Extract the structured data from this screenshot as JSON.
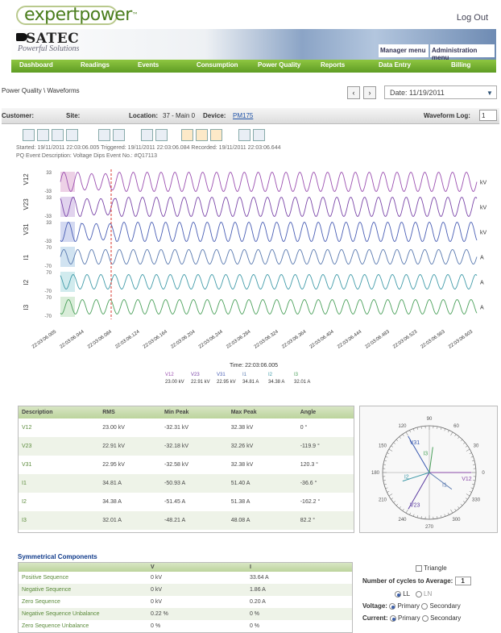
{
  "header": {
    "logo_main": "expertpower",
    "logo_tm": "™",
    "logout": "Log Out",
    "brand": "SATEC",
    "tagline": "Powerful Solutions",
    "manager_menu": "Manager menu",
    "admin_menu": "Administration menu"
  },
  "nav": [
    "Dashboard",
    "Readings",
    "Events",
    "Consumption",
    "Power Quality",
    "Reports",
    "Data Entry",
    "Billing"
  ],
  "breadcrumb": "Power Quality \\ Waveforms",
  "date": {
    "label": "Date: 11/19/2011",
    "prev": "‹",
    "next": "›",
    "caret": "▼"
  },
  "filters": {
    "customer": "Customer:",
    "site": "Site:",
    "location_label": "Location:",
    "location_value": "37 - Main 0",
    "device_label": "Device:",
    "device_value": "PM175",
    "waveform_log_label": "Waveform Log:",
    "waveform_log_value": "1"
  },
  "info": {
    "line1": "Started: 19/11/2011 22:03:06.005  Triggered: 19/11/2011 22:03:06.084  Recorded: 19/11/2011 22:03:06.644",
    "line2": "PQ Event Description: Voltage Dips  Event No.: #Q17113"
  },
  "waveform": {
    "channels": [
      {
        "name": "V12",
        "top": "33",
        "bottom": "-33",
        "color": "#9b4fb0",
        "band": "#e8c6e0",
        "unit": "kV"
      },
      {
        "name": "V23",
        "top": "33",
        "bottom": "-33",
        "color": "#7a45a8",
        "band": "#d9c8ea",
        "unit": "kV"
      },
      {
        "name": "V31",
        "top": "33",
        "bottom": "-33",
        "color": "#4a5fb5",
        "band": "#c8d0ee",
        "unit": "kV"
      },
      {
        "name": "I1",
        "top": "70",
        "bottom": "-70",
        "color": "#5a7ab0",
        "band": "#c6dcee",
        "unit": "A"
      },
      {
        "name": "I2",
        "top": "70",
        "bottom": "-70",
        "color": "#3f9aa8",
        "band": "#c6e6ea",
        "unit": "A"
      },
      {
        "name": "I3",
        "top": "70",
        "bottom": "-70",
        "color": "#4aa05a",
        "band": "#cfe8cf",
        "unit": "A"
      }
    ],
    "time_ticks": [
      "22:03:06.005",
      "22:03:06.044",
      "22:03:06.084",
      "22:03:06.124",
      "22:03:06.164",
      "22:03:06.204",
      "22:03:06.244",
      "22:03:06.284",
      "22:03:06.324",
      "22:03:06.364",
      "22:03:06.404",
      "22:03:06.444",
      "22:03:06.483",
      "22:03:06.523",
      "22:03:06.563",
      "22:03:06.603"
    ],
    "time_label": "Time: 22:03:06.005",
    "readout": [
      {
        "name": "V12",
        "value": "23.00 kV"
      },
      {
        "name": "V23",
        "value": "22.91 kV"
      },
      {
        "name": "V31",
        "value": "22.95 kV"
      },
      {
        "name": "I1",
        "value": "34.81 A"
      },
      {
        "name": "I2",
        "value": "34.38 A"
      },
      {
        "name": "I3",
        "value": "32.01 A"
      }
    ]
  },
  "table": {
    "headers": [
      "Description",
      "RMS",
      "Min Peak",
      "Max Peak",
      "Angle"
    ],
    "rows": [
      [
        "V12",
        "23.00 kV",
        "-32.31 kV",
        "32.38 kV",
        "0 °"
      ],
      [
        "V23",
        "22.91 kV",
        "-32.18 kV",
        "32.26 kV",
        "-119.9 °"
      ],
      [
        "V31",
        "22.95 kV",
        "-32.58 kV",
        "32.38 kV",
        "120.3 °"
      ],
      [
        "I1",
        "34.81 A",
        "-50.93 A",
        "51.40 A",
        "-36.6 °"
      ],
      [
        "I2",
        "34.38 A",
        "-51.45 A",
        "51.38 A",
        "-162.2 °"
      ],
      [
        "I3",
        "32.01 A",
        "-48.21 A",
        "48.08 A",
        "82.2 °"
      ]
    ]
  },
  "phasor": {
    "angles": [
      "90",
      "60",
      "30",
      "0",
      "330",
      "300",
      "270",
      "240",
      "210",
      "180",
      "150",
      "120"
    ],
    "vectors": [
      {
        "name": "V12",
        "angle": 0,
        "mag": 0.9,
        "color": "#8a4aa8"
      },
      {
        "name": "V23",
        "angle": -119.9,
        "mag": 0.9,
        "color": "#5a3aa0"
      },
      {
        "name": "V31",
        "angle": 120.3,
        "mag": 0.9,
        "color": "#3a5ab0"
      },
      {
        "name": "I1",
        "angle": -36.6,
        "mag": 0.6,
        "color": "#5a7ab0"
      },
      {
        "name": "I2",
        "angle": -162.2,
        "mag": 0.6,
        "color": "#3f9aa8"
      },
      {
        "name": "I3",
        "angle": 82.2,
        "mag": 0.55,
        "color": "#4aa05a"
      }
    ]
  },
  "symmetrical": {
    "title": "Symmetrical Components",
    "headers": [
      "",
      "V",
      "I"
    ],
    "rows": [
      [
        "Positive Sequence",
        "0 kV",
        "33.64 A"
      ],
      [
        "Negative Sequence",
        "0 kV",
        "1.86 A"
      ],
      [
        "Zero Sequence",
        "0 kV",
        "0.20 A"
      ],
      [
        "Negative Sequence Unbalance",
        "0.22 %",
        "0 %"
      ],
      [
        "Zero Sequence Unbalance",
        "0 %",
        "0 %"
      ]
    ]
  },
  "options": {
    "triangle": "Triangle",
    "cycles_label": "Number of cycles to Average:",
    "cycles_value": "1",
    "ll": "LL",
    "ln": "LN",
    "voltage_label": "Voltage:",
    "current_label": "Current:",
    "primary": "Primary",
    "secondary": "Secondary"
  }
}
